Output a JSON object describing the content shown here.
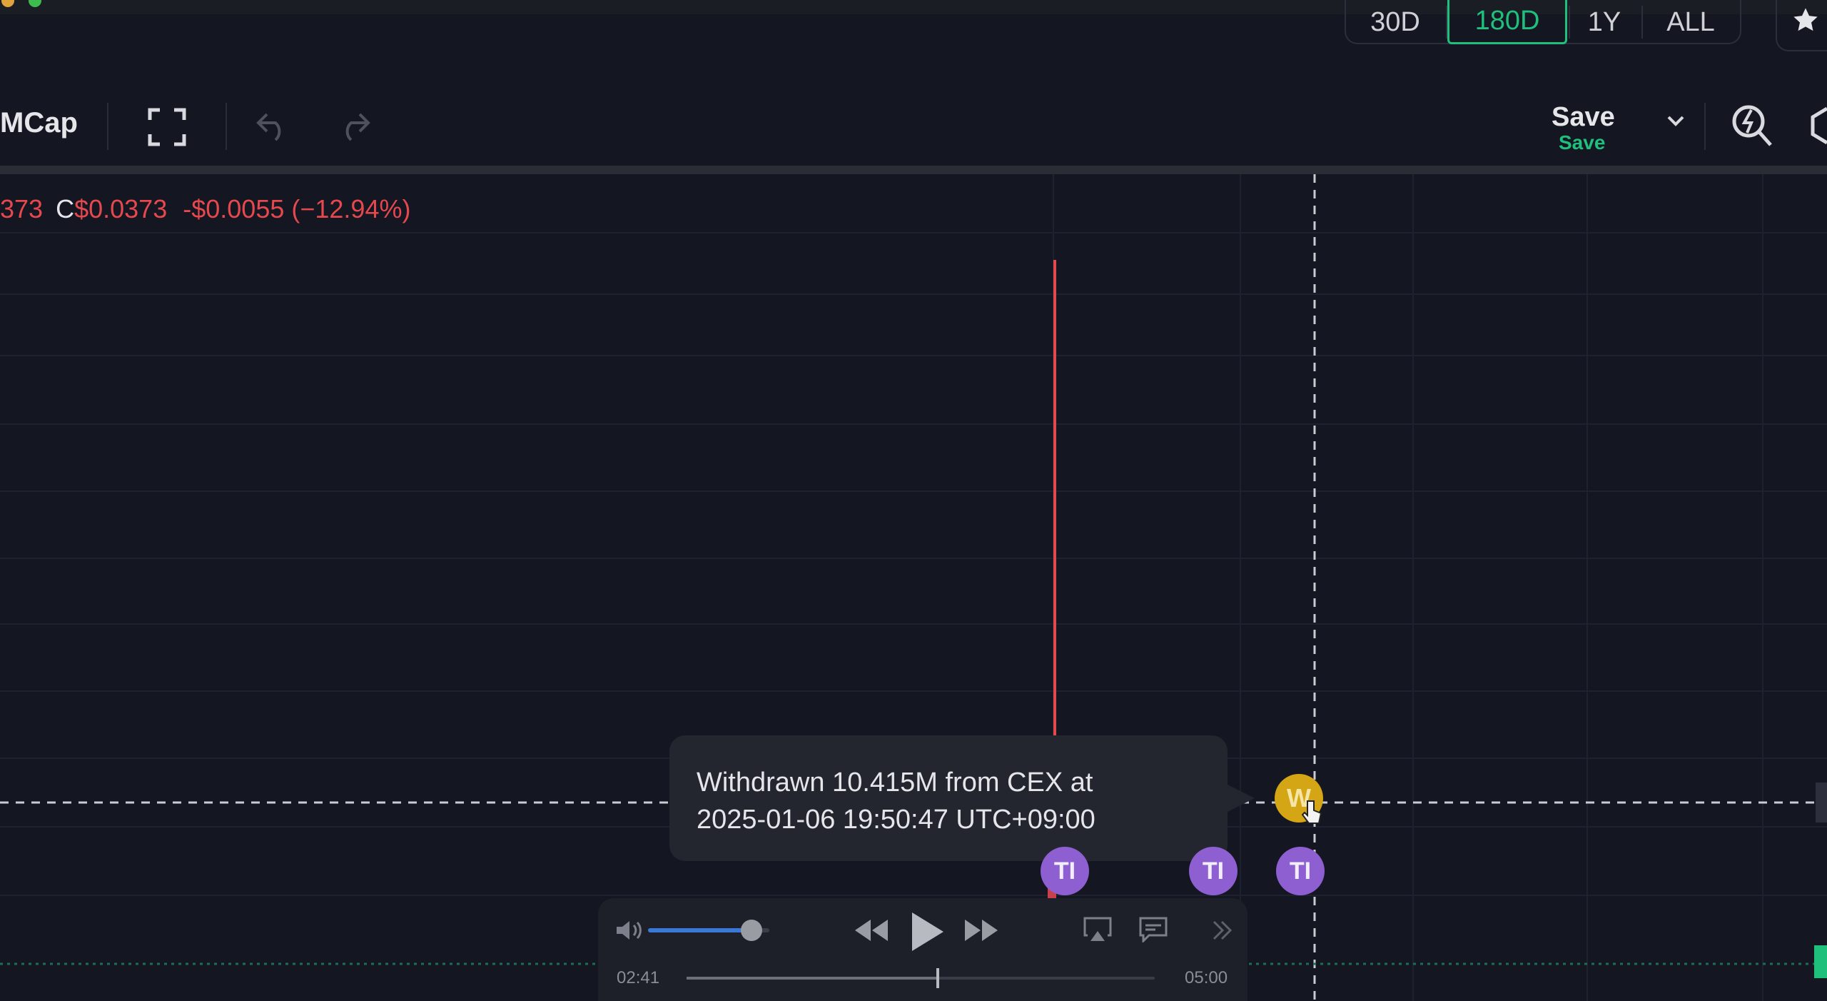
{
  "range_buttons": [
    {
      "label": "30D",
      "active": false
    },
    {
      "label": "180D",
      "active": true
    },
    {
      "label": "1Y",
      "active": false
    },
    {
      "label": "ALL",
      "active": false
    }
  ],
  "toolbar": {
    "mcap_label": "MCap",
    "save_label": "Save",
    "save_sub": "Save"
  },
  "ohlc": {
    "prefix": "373",
    "close_letter": "C",
    "close_value": "$0.0373",
    "change": "-$0.0055 (−12.94%)"
  },
  "tooltip": {
    "line1": "Withdrawn 10.415M from CEX at",
    "line2": "2025-01-06 19:50:47 UTC+09:00"
  },
  "markers": {
    "w": "W",
    "ti": "TI"
  },
  "media": {
    "elapsed": "02:41",
    "duration": "05:00",
    "volume_level": 0.85,
    "progress": 0.537
  },
  "colors": {
    "background": "#141622",
    "accent": "#1fbf7c",
    "down": "#e5484d",
    "marker_purple": "#8e5fd0",
    "marker_gold": "#d4a514"
  }
}
